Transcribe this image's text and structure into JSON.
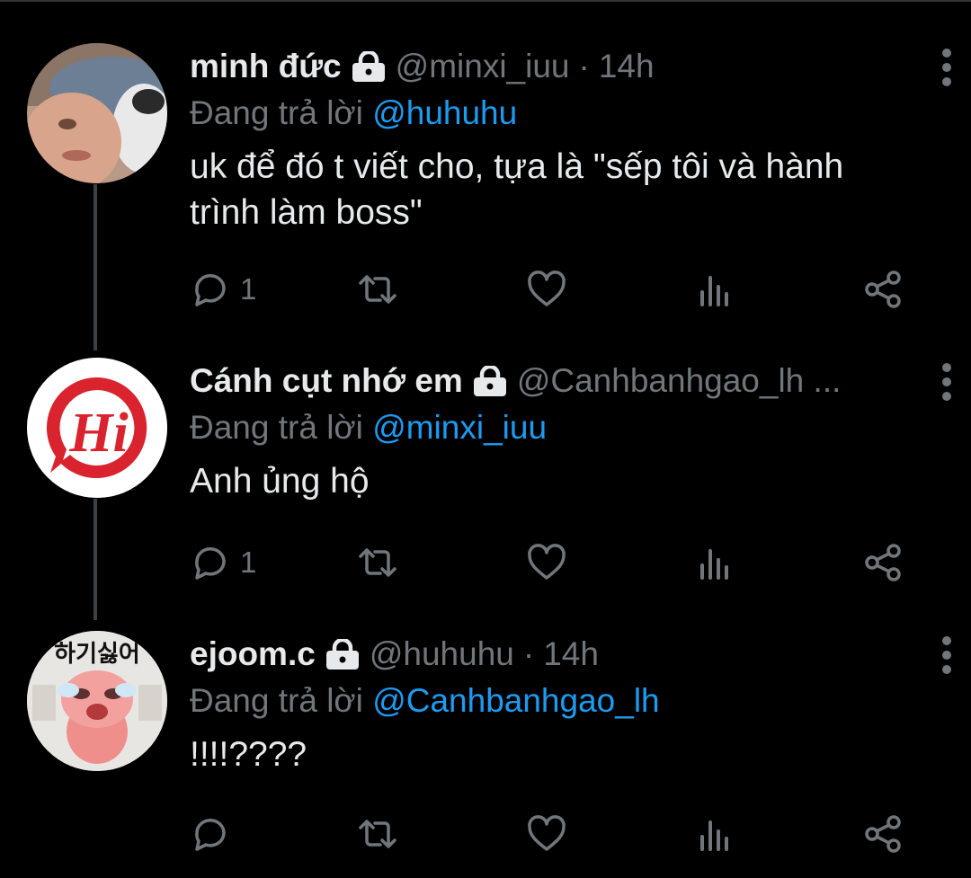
{
  "tweets": [
    {
      "name": "minh đức",
      "handle": "@minxi_iuu",
      "time": "14h",
      "reply_prefix": "Đang trả lời",
      "reply_to": "@huhuhu",
      "text": "uk để đó t viết cho, tựa là \"sếp tôi và hành trình làm boss\"",
      "reply_count": "1",
      "avatar_icon": "person-with-pet-photo"
    },
    {
      "name": "Cánh cụt nhớ em",
      "handle": "@Canhbanhgao_lh ...",
      "time": "",
      "reply_prefix": "Đang trả lời",
      "reply_to": "@minxi_iuu",
      "text": "Anh ủng hộ",
      "reply_count": "1",
      "avatar_icon": "hi-speech-bubble-logo"
    },
    {
      "name": "ejoom.c",
      "handle": "@huhuhu",
      "time": "14h",
      "reply_prefix": "Đang trả lời",
      "reply_to": "@Canhbanhgao_lh",
      "text": "!!!!????",
      "reply_count": "",
      "avatar_icon": "crying-pink-character-sticker",
      "avatar_caption": "하기싫어"
    }
  ],
  "colors": {
    "background": "#000000",
    "text": "#e7e9ea",
    "muted": "#71767b",
    "link": "#1d9bf0"
  }
}
